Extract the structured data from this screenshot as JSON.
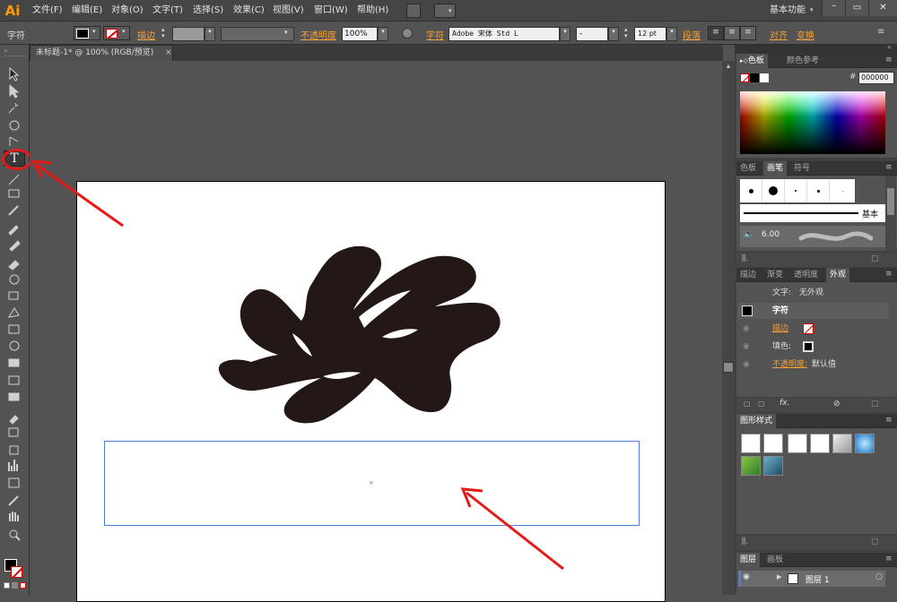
{
  "app": {
    "logo": "Ai",
    "workspace": "基本功能"
  },
  "menus": [
    "文件(F)",
    "编辑(E)",
    "对象(O)",
    "文字(T)",
    "选择(S)",
    "效果(C)",
    "视图(V)",
    "窗口(W)",
    "帮助(H)"
  ],
  "control": {
    "label": "字符",
    "stroke_label": "描边",
    "opacity_label": "不透明度",
    "opacity_value": "100%",
    "char_label": "字符",
    "font_name": "Adobe 宋体 Std L",
    "font_style": "-",
    "font_size": "12 pt",
    "para_label": "段落",
    "align_label": "对齐",
    "transform_label": "变换"
  },
  "document": {
    "tab_title": "未标题-1* @ 100% (RGB/预览)"
  },
  "color_panel": {
    "tab_color": "色板",
    "tab_guide": "颜色参考",
    "hex_prefix": "#",
    "hex_value": "000000"
  },
  "brush_panel": {
    "tab_swatches": "色板",
    "tab_brushes": "画笔",
    "tab_symbols": "符号",
    "basic_label": "基本",
    "brush_size": "6.00"
  },
  "appearance_panel": {
    "tabs": [
      "描边",
      "渐变",
      "透明度",
      "外观"
    ],
    "text_label": "文字:",
    "text_value": "无外观",
    "char_row": "字符",
    "stroke_row": "描边",
    "fill_row": "填色:",
    "opacity_row": "不透明度:",
    "opacity_value": "默认值",
    "fx_label": "fx."
  },
  "graphic_styles": {
    "tab": "图形样式"
  },
  "layers_panel": {
    "tab_layers": "图层",
    "tab_artboards": "画板",
    "layer_name": "图层 1"
  },
  "colors": {
    "accent": "#f7a035",
    "annotation": "#e41b17",
    "selection": "#4f7fd9"
  }
}
